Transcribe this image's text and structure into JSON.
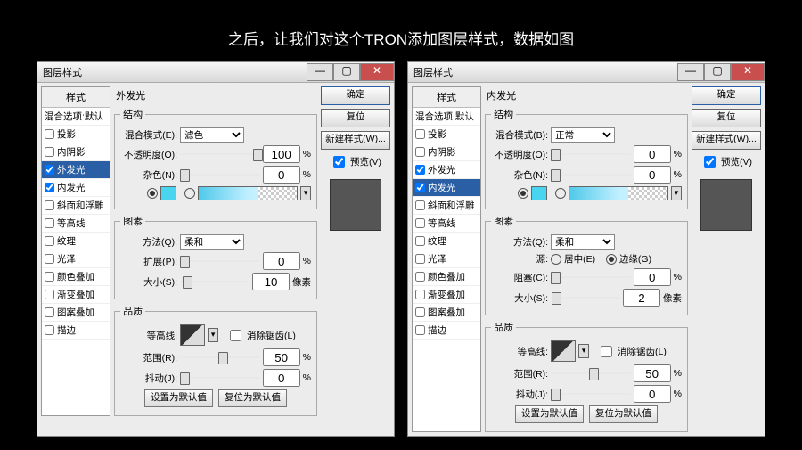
{
  "caption": "之后，让我们对这个TRON添加图层样式，数据如图",
  "windowTitle": "图层样式",
  "closeGlyph": "✕",
  "stylesHeader": "样式",
  "styleList": [
    {
      "label": "混合选项:默认",
      "cb": null
    },
    {
      "label": "投影",
      "cb": false
    },
    {
      "label": "内阴影",
      "cb": false
    },
    {
      "label": "外发光",
      "cb": true
    },
    {
      "label": "内发光",
      "cb": true
    },
    {
      "label": "斜面和浮雕",
      "cb": false
    },
    {
      "label": "等高线",
      "cb": false
    },
    {
      "label": "纹理",
      "cb": false
    },
    {
      "label": "光泽",
      "cb": false
    },
    {
      "label": "颜色叠加",
      "cb": false
    },
    {
      "label": "渐变叠加",
      "cb": false
    },
    {
      "label": "图案叠加",
      "cb": false
    },
    {
      "label": "描边",
      "cb": false
    }
  ],
  "buttons": {
    "ok": "确定",
    "cancel": "复位",
    "new": "新建样式(W)...",
    "preview": "预览(V)"
  },
  "leftPanel": {
    "selectedIdx": 3,
    "sectionTitle": "外发光",
    "group1": "结构",
    "blendLabel": "混合模式(E):",
    "blendValue": "滤色",
    "opacityLabel": "不透明度(O):",
    "opacity": "100",
    "pct": "%",
    "noiseLabel": "杂色(N):",
    "noise": "0",
    "swatch": "#49d4ef",
    "group2": "图素",
    "methodLabel": "方法(Q):",
    "methodValue": "柔和",
    "spreadLabel": "扩展(P):",
    "spread": "0",
    "sizeLabel": "大小(S):",
    "size": "10",
    "px": "像素",
    "group3": "品质",
    "contourLabel": "等高线:",
    "antiLabel": "消除锯齿(L)",
    "rangeLabel": "范围(R):",
    "range": "50",
    "jitterLabel": "抖动(J):",
    "jitter": "0",
    "defBtn": "设置为默认值",
    "resetBtn": "复位为默认值"
  },
  "rightPanel": {
    "selectedIdx": 4,
    "sectionTitle": "内发光",
    "group1": "结构",
    "blendLabel": "混合模式(B):",
    "blendValue": "正常",
    "opacityLabel": "不透明度(O):",
    "opacity": "0",
    "pct": "%",
    "noiseLabel": "杂色(N):",
    "noise": "0",
    "swatch": "#49d4ef",
    "group2": "图素",
    "methodLabel": "方法(Q):",
    "methodValue": "柔和",
    "sourceLabel": "源:",
    "sourceCenter": "居中(E)",
    "sourceEdge": "边缘(G)",
    "chokeLabel": "阻塞(C):",
    "choke": "0",
    "sizeLabel": "大小(S):",
    "size": "2",
    "px": "像素",
    "group3": "品质",
    "contourLabel": "等高线:",
    "antiLabel": "消除锯齿(L)",
    "rangeLabel": "范围(R):",
    "range": "50",
    "jitterLabel": "抖动(J):",
    "jitter": "0",
    "defBtn": "设置为默认值",
    "resetBtn": "复位为默认值"
  }
}
